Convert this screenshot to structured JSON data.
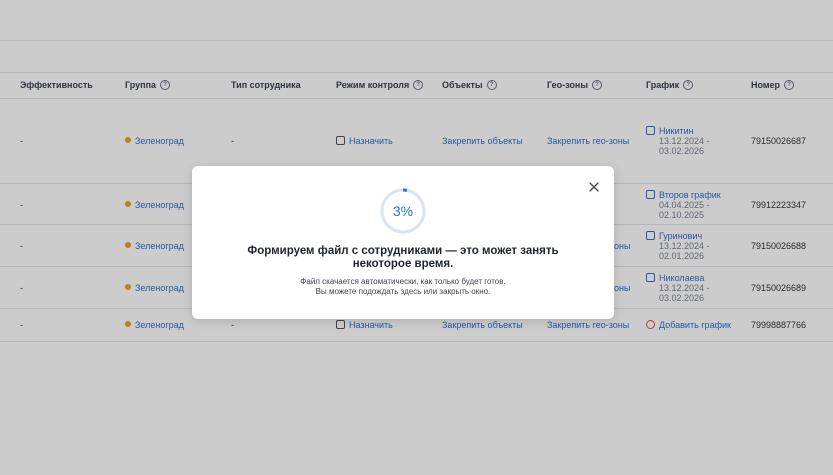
{
  "columns": [
    {
      "label": "Эффективность",
      "help": false
    },
    {
      "label": "Группа",
      "help": true
    },
    {
      "label": "Тип сотрудника",
      "help": false
    },
    {
      "label": "Режим контроля",
      "help": true
    },
    {
      "label": "Объекты",
      "help": true
    },
    {
      "label": "Гео-зоны",
      "help": true
    },
    {
      "label": "График",
      "help": true
    },
    {
      "label": "Номер",
      "help": true
    }
  ],
  "rows": [
    {
      "efficiency": "-",
      "group": "Зеленоград",
      "type": "-",
      "control": "Назначить",
      "objects": "Закрепить объекты",
      "geo": "Закрепить гео-зоны",
      "schedule_name": "Никитин",
      "schedule_from": "13.12.2024 -",
      "schedule_to": "03.02.2026",
      "phone": "79150026687"
    },
    {
      "efficiency": "-",
      "group": "Зеленоград",
      "type": "",
      "control": "",
      "objects": "",
      "geo": "",
      "schedule_name": "Второв график",
      "schedule_from": "04.04.2025 -",
      "schedule_to": "02.10.2025",
      "phone": "79912223347"
    },
    {
      "efficiency": "-",
      "group": "Зеленоград",
      "type": "",
      "control": "",
      "objects": "",
      "geo": "оны",
      "schedule_name": "Гуринович",
      "schedule_from": "13.12.2024 -",
      "schedule_to": "02.01.2026",
      "phone": "79150026688"
    },
    {
      "efficiency": "-",
      "group": "Зеленоград",
      "type": "",
      "control": "",
      "objects": "",
      "geo": "оны",
      "schedule_name": "Николаева",
      "schedule_from": "13.12.2024 -",
      "schedule_to": "03.02.2026",
      "phone": "79150026689"
    },
    {
      "efficiency": "-",
      "group": "Зеленоград",
      "type": "-",
      "control": "Назначить",
      "objects": "Закрепить объекты",
      "geo": "Закрепить гео-зоны",
      "schedule_add": "Добавить график",
      "phone": "79998887766"
    }
  ],
  "modal": {
    "progress_percent": 3,
    "progress_label": "3%",
    "title_line1": "Формируем файл с сотрудниками — это может занять",
    "title_line2": "некоторое время.",
    "sub_line1": "Файл скачается автоматически, как только будет готов.",
    "sub_line2": "Вы можете подождать здесь или закрыть окно.",
    "accent_color": "#2f6fd1"
  }
}
